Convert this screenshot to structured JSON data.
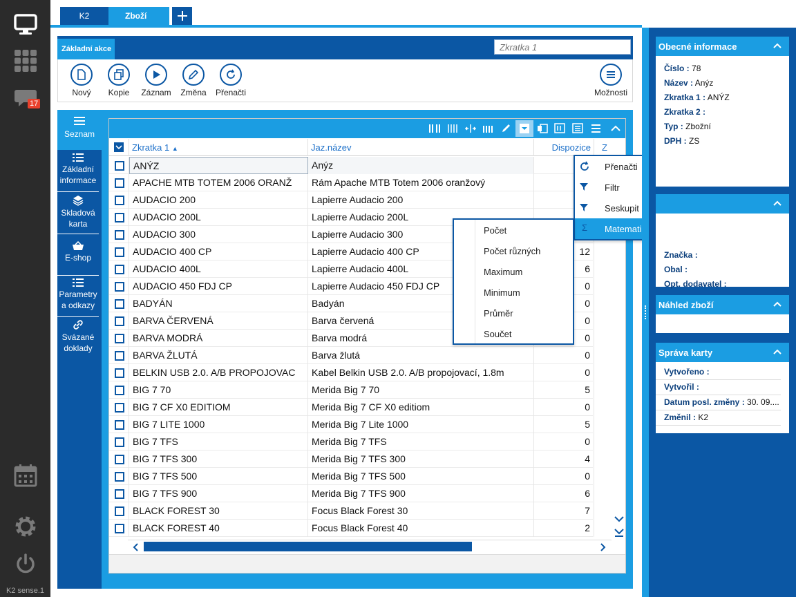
{
  "leftbar": {
    "chat_badge": "17",
    "footer": "K2 sense.1"
  },
  "tabs": [
    {
      "label": "K2"
    },
    {
      "label": "Zboží"
    }
  ],
  "actionbar": {
    "title": "Základní akce",
    "shortcut_placeholder": "Zkratka 1"
  },
  "toolbar": {
    "new": "Nový",
    "copy": "Kopie",
    "record": "Záznam",
    "change": "Změna",
    "reload": "Přenačti",
    "options": "Možnosti"
  },
  "sidenav": [
    {
      "label": "Seznam"
    },
    {
      "label": "Základní informace"
    },
    {
      "label": "Skladová karta"
    },
    {
      "label": "E-shop"
    },
    {
      "label": "Parametry a odkazy"
    },
    {
      "label": "Svázané doklady"
    }
  ],
  "grid": {
    "columns": [
      "Zkratka 1",
      "Jaz.název",
      "Dispozice",
      "Z"
    ],
    "rows": [
      [
        "ANÝZ",
        "Anýz",
        ""
      ],
      [
        "APACHE MTB TOTEM 2006 ORANŽ",
        "Rám Apache MTB Totem 2006 oranžový",
        ""
      ],
      [
        "AUDACIO 200",
        "Lapierre Audacio 200",
        ""
      ],
      [
        "AUDACIO 200L",
        "Lapierre Audacio 200L",
        ""
      ],
      [
        "AUDACIO 300",
        "Lapierre Audacio 300",
        ""
      ],
      [
        "AUDACIO 400 CP",
        "Lapierre Audacio 400 CP",
        "12"
      ],
      [
        "AUDACIO 400L",
        "Lapierre Audacio 400L",
        "6"
      ],
      [
        "AUDACIO 450 FDJ CP",
        "Lapierre Audacio 450 FDJ CP",
        "0"
      ],
      [
        "BADYÁN",
        "Badyán",
        "0"
      ],
      [
        "BARVA ČERVENÁ",
        "Barva červená",
        "0"
      ],
      [
        "BARVA MODRÁ",
        "Barva modrá",
        "0"
      ],
      [
        "BARVA ŽLUTÁ",
        "Barva žlutá",
        "0"
      ],
      [
        "BELKIN USB 2.0. A/B PROPOJOVAC",
        "Kabel Belkin USB 2.0. A/B propojovací, 1.8m",
        "0"
      ],
      [
        "BIG 7 70",
        "Merida Big 7 70",
        "5"
      ],
      [
        "BIG 7 CF X0 EDITIOM",
        "Merida Big 7 CF X0 editiom",
        "0"
      ],
      [
        "BIG 7 LITE 1000",
        "Merida Big 7 Lite 1000",
        "5"
      ],
      [
        "BIG 7 TFS",
        "Merida Big 7 TFS",
        "0"
      ],
      [
        "BIG 7 TFS 300",
        "Merida Big 7 TFS 300",
        "4"
      ],
      [
        "BIG 7 TFS 500",
        "Merida Big 7 TFS 500",
        "0"
      ],
      [
        "BIG 7 TFS 900",
        "Merida Big 7 TFS 900",
        "6"
      ],
      [
        "BLACK FOREST 30",
        "Focus Black Forest 30",
        "7"
      ],
      [
        "BLACK FOREST 40",
        "Focus Black Forest 40",
        "2"
      ]
    ]
  },
  "context_menu": {
    "items": [
      "Přenačti",
      "Filtr",
      "Seskupit",
      "Matematické operace"
    ],
    "submenu": [
      "Počet",
      "Počet různých",
      "Maximum",
      "Minimum",
      "Průměr",
      "Součet"
    ]
  },
  "right_panel": {
    "general": {
      "title": "Obecné informace",
      "fields": [
        {
          "label": "Číslo :",
          "value": "78"
        },
        {
          "label": "Název :",
          "value": "Anýz"
        },
        {
          "label": "Zkratka 1 :",
          "value": "ANÝZ"
        },
        {
          "label": "Zkratka 2 :",
          "value": ""
        },
        {
          "label": "Typ :",
          "value": "Zbožní"
        },
        {
          "label": "DPH :",
          "value": "ZS"
        }
      ]
    },
    "second": {
      "fields": [
        {
          "label": "Značka :",
          "value": ""
        },
        {
          "label": "Obal :",
          "value": ""
        },
        {
          "label": "Opt. dodavatel :",
          "value": ""
        }
      ]
    },
    "preview": {
      "title": "Náhled zboží"
    },
    "card": {
      "title": "Správa karty",
      "fields": [
        {
          "label": "Vytvořeno :",
          "value": ""
        },
        {
          "label": "Vytvořil :",
          "value": ""
        },
        {
          "label": "Datum posl. změny :",
          "value": "30. 09...."
        },
        {
          "label": "Změnil :",
          "value": "K2"
        }
      ]
    }
  },
  "colors": {
    "dark_blue": "#0b57a4",
    "light_blue": "#1b9de2",
    "sidebar": "#2b2b2b"
  }
}
